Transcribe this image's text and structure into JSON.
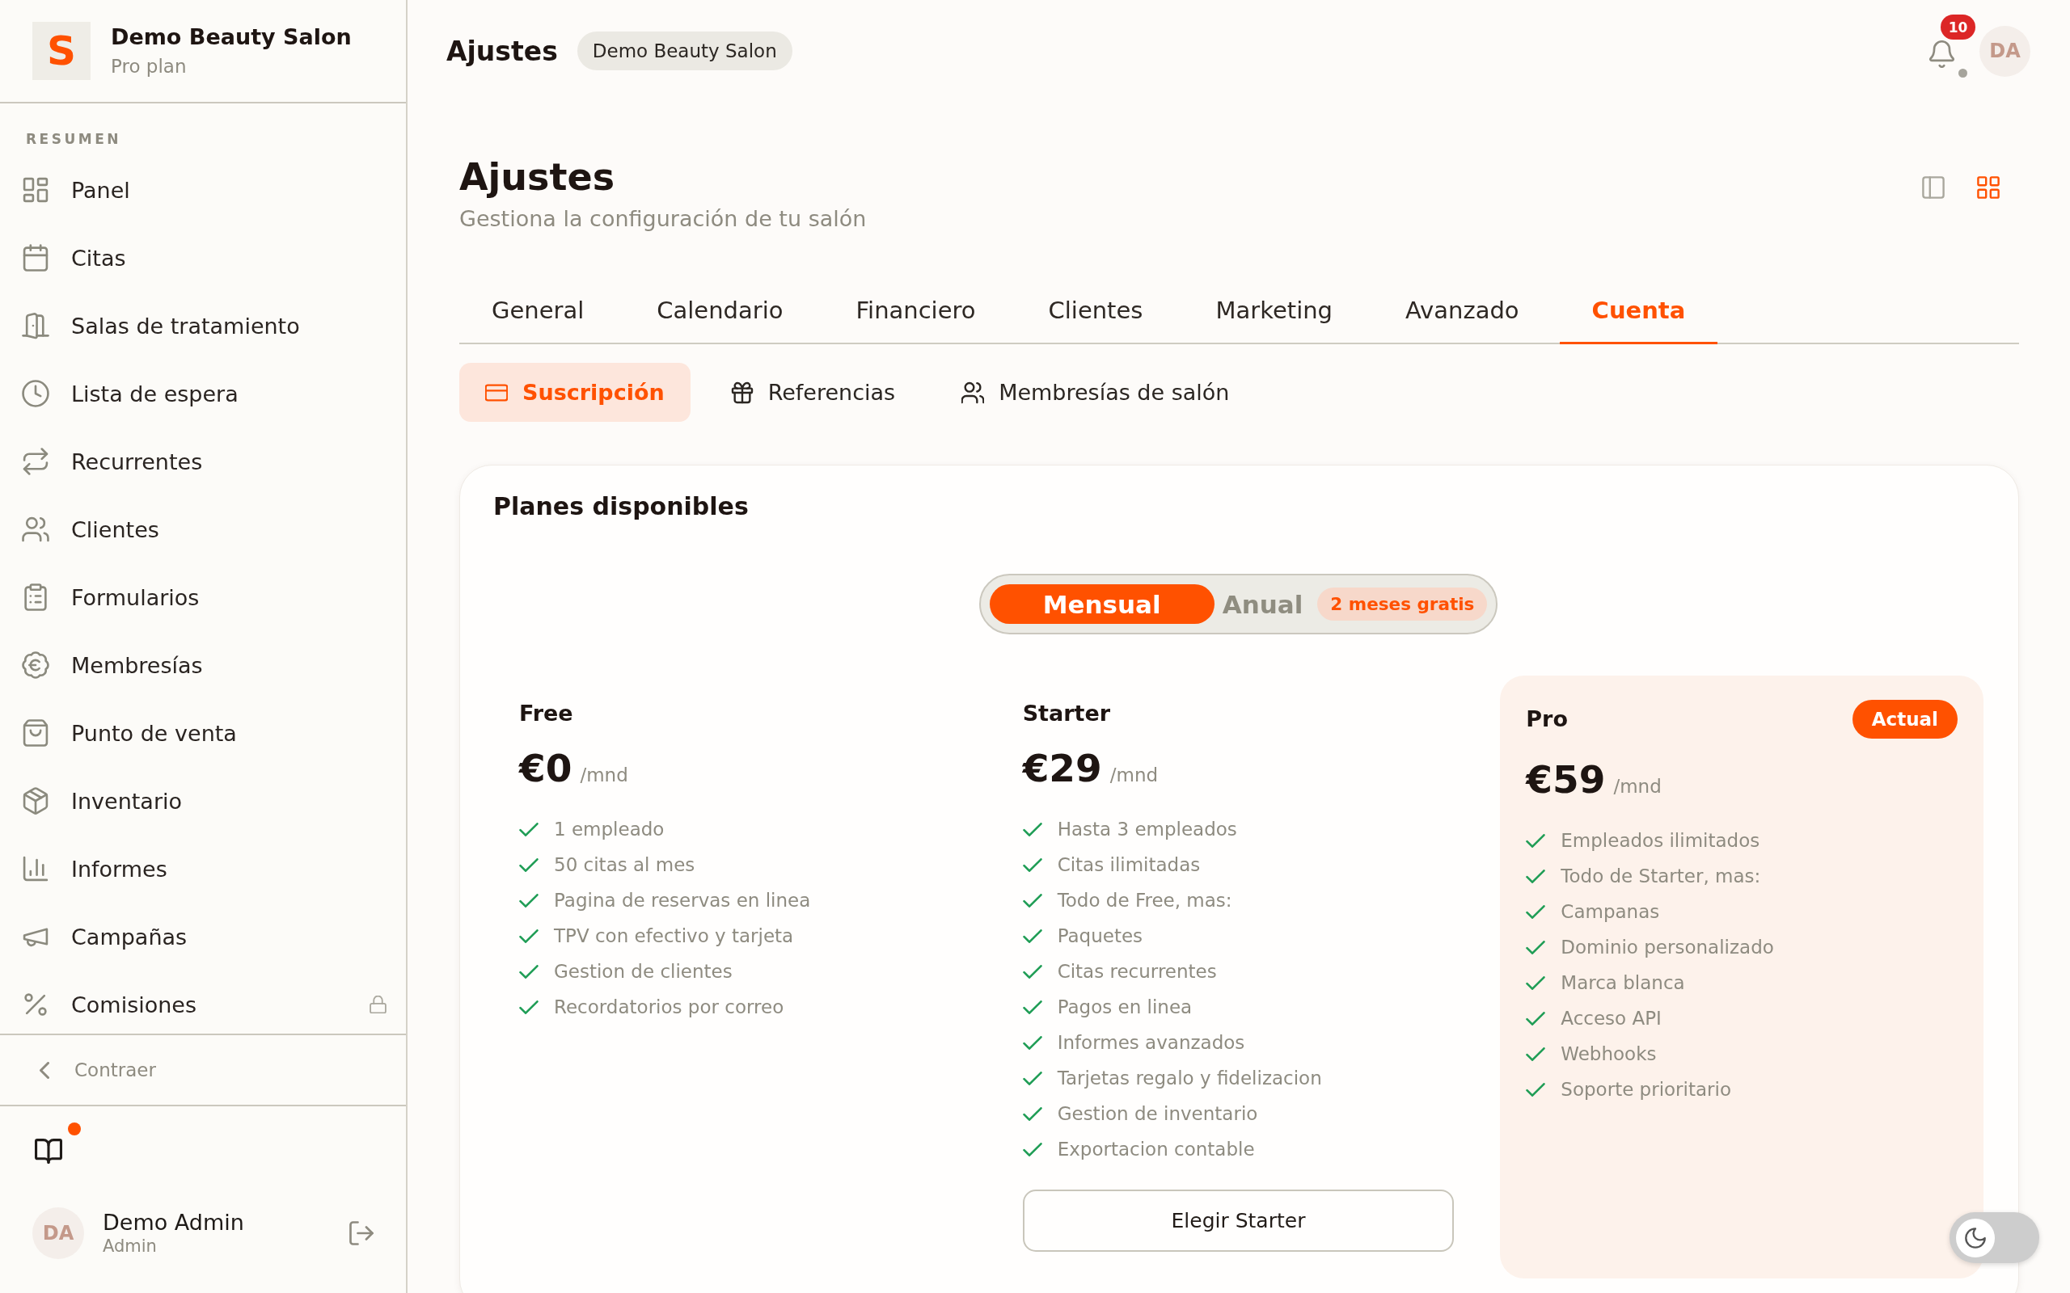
{
  "sidebar": {
    "logo": "S",
    "title": "Demo Beauty Salon",
    "plan": "Pro plan",
    "section_label": "RESUMEN",
    "items": [
      {
        "label": "Panel",
        "selected": false,
        "locked": false
      },
      {
        "label": "Citas",
        "selected": false,
        "locked": false
      },
      {
        "label": "Salas de tratamiento",
        "selected": false,
        "locked": false
      },
      {
        "label": "Lista de espera",
        "selected": false,
        "locked": false
      },
      {
        "label": "Recurrentes",
        "selected": false,
        "locked": false
      },
      {
        "label": "Clientes",
        "selected": false,
        "locked": false
      },
      {
        "label": "Formularios",
        "selected": false,
        "locked": false
      },
      {
        "label": "Membresías",
        "selected": false,
        "locked": false
      },
      {
        "label": "Punto de venta",
        "selected": false,
        "locked": false
      },
      {
        "label": "Inventario",
        "selected": false,
        "locked": false
      },
      {
        "label": "Informes",
        "selected": false,
        "locked": false
      },
      {
        "label": "Campañas",
        "selected": false,
        "locked": false
      },
      {
        "label": "Comisiones",
        "selected": false,
        "locked": true
      }
    ],
    "collapse_label": "Contraer",
    "docs_unread": true,
    "user": {
      "initials": "DA",
      "name": "Demo Admin",
      "role": "Admin"
    }
  },
  "header": {
    "title": "Ajustes",
    "salon_badge": "Demo Beauty Salon",
    "notification_count": "10",
    "avatar_initials": "DA"
  },
  "page": {
    "title": "Ajustes",
    "subtitle": "Gestiona la configuración de tu salón",
    "view_modes": [
      {
        "selected": false
      },
      {
        "selected": true
      }
    ]
  },
  "tabs": [
    {
      "label": "General",
      "selected": false
    },
    {
      "label": "Calendario",
      "selected": false
    },
    {
      "label": "Financiero",
      "selected": false
    },
    {
      "label": "Clientes",
      "selected": false
    },
    {
      "label": "Marketing",
      "selected": false
    },
    {
      "label": "Avanzado",
      "selected": false
    },
    {
      "label": "Cuenta",
      "selected": true
    }
  ],
  "subtabs": [
    {
      "label": "Suscripción",
      "selected": true
    },
    {
      "label": "Referencias",
      "selected": false
    },
    {
      "label": "Membresías de salón",
      "selected": false
    }
  ],
  "plans_section": {
    "title": "Planes disponibles",
    "billing_options": [
      {
        "label": "Mensual",
        "selected": true
      },
      {
        "label": "Anual",
        "selected": false
      }
    ],
    "billing_badge": "2 meses gratis",
    "plans": [
      {
        "name": "Free",
        "price": "€0",
        "period": "/mnd",
        "current": false,
        "features": [
          "1 empleado",
          "50 citas al mes",
          "Pagina de reservas en linea",
          "TPV con efectivo y tarjeta",
          "Gestion de clientes",
          "Recordatorios por correo"
        ]
      },
      {
        "name": "Starter",
        "price": "€29",
        "period": "/mnd",
        "current": false,
        "features": [
          "Hasta 3 empleados",
          "Citas ilimitadas",
          "Todo de Free, mas:",
          "Paquetes",
          "Citas recurrentes",
          "Pagos en linea",
          "Informes avanzados",
          "Tarjetas regalo y fidelizacion",
          "Gestion de inventario",
          "Exportacion contable"
        ],
        "button": "Elegir Starter"
      },
      {
        "name": "Pro",
        "price": "€59",
        "period": "/mnd",
        "current": true,
        "badge": "Actual",
        "features": [
          "Empleados ilimitados",
          "Todo de Starter, mas:",
          "Campanas",
          "Dominio personalizado",
          "Marca blanca",
          "Acceso API",
          "Webhooks",
          "Soporte prioritario"
        ]
      }
    ]
  },
  "theme_toggle": {
    "on": false
  }
}
